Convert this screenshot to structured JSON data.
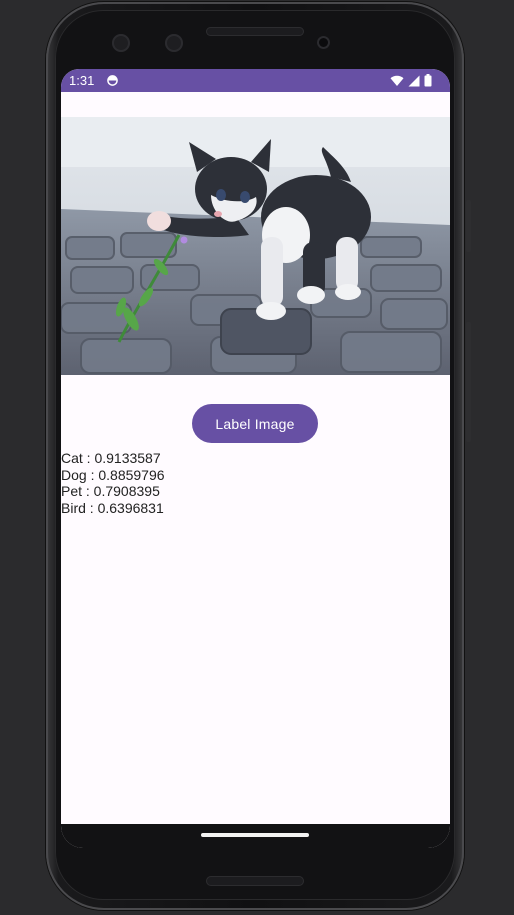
{
  "status_bar": {
    "time": "1:31",
    "color": "#6750a4",
    "icons": [
      "app-notification-icon",
      "wifi-icon",
      "cell-signal-icon",
      "battery-icon"
    ]
  },
  "image": {
    "subject": "kitten-with-flower",
    "icon": "photo"
  },
  "label_button": {
    "label": "Label Image",
    "color": "#6750a4"
  },
  "results": [
    {
      "text": "Cat : 0.9133587"
    },
    {
      "text": "Dog : 0.8859796"
    },
    {
      "text": "Pet : 0.7908395"
    },
    {
      "text": "Bird : 0.6396831"
    }
  ]
}
